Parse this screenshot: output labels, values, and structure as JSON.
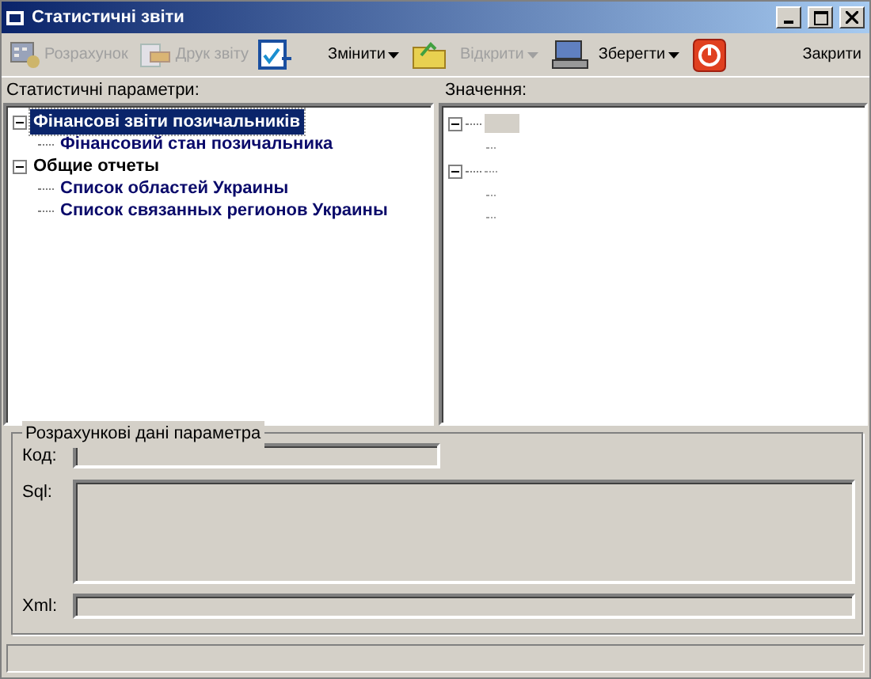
{
  "window": {
    "title": "Статистичні звіти"
  },
  "toolbar": [
    {
      "kind": "button",
      "label": "Розрахунок",
      "disabled": true
    },
    {
      "kind": "button",
      "label": "Друк звіту",
      "disabled": true
    },
    {
      "kind": "icon",
      "disabled": false
    },
    {
      "kind": "dropdown",
      "label": "Змінити",
      "disabled": false
    },
    {
      "kind": "icon",
      "disabled": false
    },
    {
      "kind": "dropdown",
      "label": "Відкрити",
      "disabled": true
    },
    {
      "kind": "icon",
      "disabled": false
    },
    {
      "kind": "dropdown",
      "label": "Зберегти",
      "disabled": false
    },
    {
      "kind": "icon",
      "disabled": false
    },
    {
      "kind": "text",
      "label": "Закрити",
      "disabled": false
    }
  ],
  "parameters": {
    "label": "Статистичні параметри:",
    "tree": [
      {
        "label": "Фінансові звіти позичальників",
        "expanded": true,
        "selected": true,
        "children": [
          {
            "label": "Фінансовий стан позичальника",
            "selected": false
          }
        ]
      },
      {
        "label": "Общие отчеты",
        "expanded": true,
        "selected": false,
        "children": [
          {
            "label": "Список областей Украины",
            "selected": false
          },
          {
            "label": "Список связанных регионов Украины",
            "selected": false
          }
        ]
      }
    ]
  },
  "values": {
    "label": "Значення:",
    "tree": [
      {
        "expanded": true,
        "selected": true,
        "children": [
          {
            "selected": false
          }
        ]
      },
      {
        "expanded": true,
        "selected": false,
        "children": [
          {
            "selected": false
          },
          {
            "selected": false
          }
        ]
      }
    ]
  },
  "details": {
    "title": "Розрахункові дані параметра",
    "fields": [
      {
        "kind": "line",
        "label": "Код:",
        "disabled": true
      },
      {
        "kind": "area",
        "label": "Sql:",
        "disabled": true
      },
      {
        "kind": "wide",
        "label": "Xml:",
        "disabled": true
      }
    ]
  }
}
